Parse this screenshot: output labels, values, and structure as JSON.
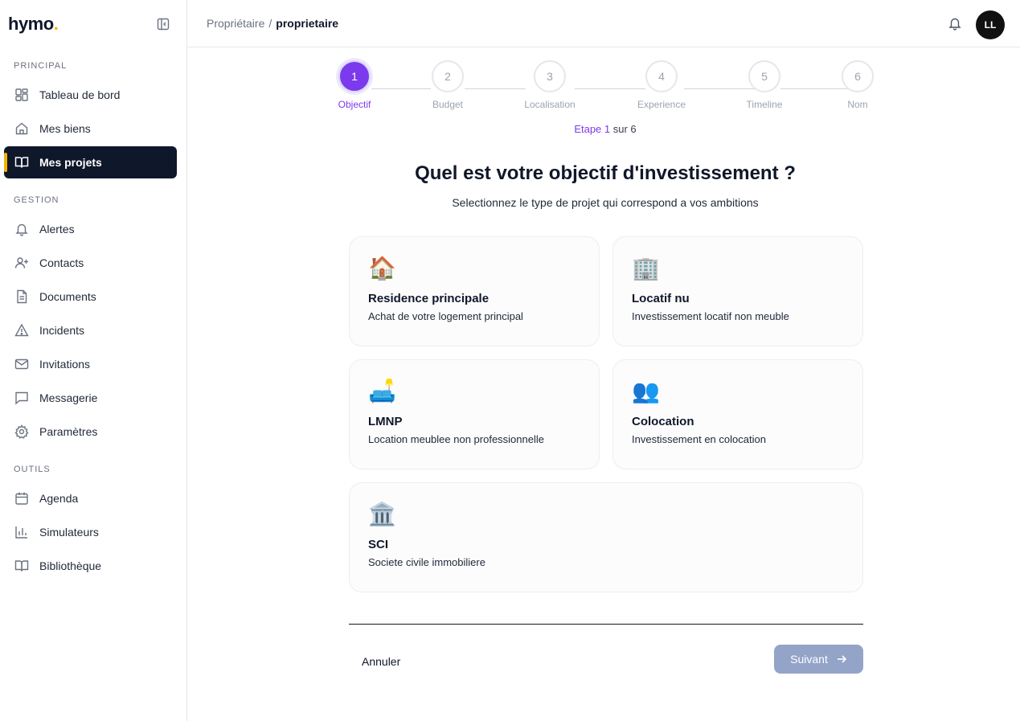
{
  "brand": {
    "name": "hymo",
    "dot": "."
  },
  "sidebar": {
    "sections": [
      {
        "label": "PRINCIPAL"
      },
      {
        "label": "GESTION"
      },
      {
        "label": "OUTILS"
      }
    ],
    "items": [
      {
        "label": "Tableau de bord",
        "icon": "dashboard-icon"
      },
      {
        "label": "Mes biens",
        "icon": "home-icon"
      },
      {
        "label": "Mes projets",
        "icon": "book-icon",
        "active": true
      },
      {
        "label": "Alertes",
        "icon": "bell-icon"
      },
      {
        "label": "Contacts",
        "icon": "user-plus-icon"
      },
      {
        "label": "Documents",
        "icon": "document-icon"
      },
      {
        "label": "Incidents",
        "icon": "warning-icon"
      },
      {
        "label": "Invitations",
        "icon": "mail-icon"
      },
      {
        "label": "Messagerie",
        "icon": "message-icon"
      },
      {
        "label": "Paramètres",
        "icon": "gear-icon"
      },
      {
        "label": "Agenda",
        "icon": "calendar-icon"
      },
      {
        "label": "Simulateurs",
        "icon": "chart-icon"
      },
      {
        "label": "Bibliothèque",
        "icon": "library-icon"
      }
    ]
  },
  "header": {
    "breadcrumb_parent": "Propriétaire",
    "breadcrumb_sep": "/",
    "breadcrumb_current": "proprietaire",
    "avatar_initials": "LL"
  },
  "stepper": {
    "steps": [
      {
        "number": "1",
        "label": "Objectif",
        "active": true
      },
      {
        "number": "2",
        "label": "Budget"
      },
      {
        "number": "3",
        "label": "Localisation"
      },
      {
        "number": "4",
        "label": "Experience"
      },
      {
        "number": "5",
        "label": "Timeline"
      },
      {
        "number": "6",
        "label": "Nom"
      }
    ],
    "counter_prefix": "Etape 1",
    "counter_suffix": "sur 6"
  },
  "content": {
    "title": "Quel est votre objectif d'investissement ?",
    "subtitle": "Selectionnez le type de projet qui correspond a vos ambitions",
    "options": [
      {
        "emoji": "🏠",
        "title": "Residence principale",
        "desc": "Achat de votre logement principal"
      },
      {
        "emoji": "🏢",
        "title": "Locatif nu",
        "desc": "Investissement locatif non meuble"
      },
      {
        "emoji": "🛋️",
        "title": "LMNP",
        "desc": "Location meublee non professionnelle"
      },
      {
        "emoji": "👥",
        "title": "Colocation",
        "desc": "Investissement en colocation"
      },
      {
        "emoji": "🏛️",
        "title": "SCI",
        "desc": "Societe civile immobiliere"
      }
    ]
  },
  "actions": {
    "cancel_label": "Annuler",
    "next_label": "Suivant"
  },
  "colors": {
    "accent": "#7c3aed",
    "sidebar_active": "#0f172a",
    "brand_yellow": "#f5b301",
    "next_disabled": "#94a3c8"
  }
}
